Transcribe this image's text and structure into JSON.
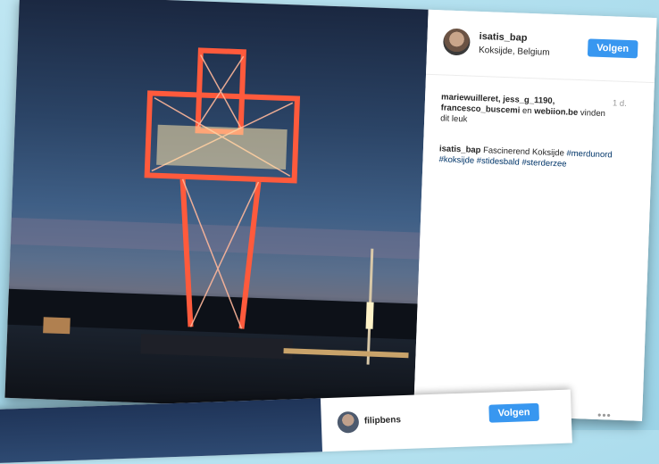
{
  "post": {
    "username": "isatis_bap",
    "location": "Koksijde, Belgium",
    "follow_label": "Volgen",
    "likes_users": "mariewuilleret, jess_g_1190, francesco_buscemi",
    "likes_and": "en",
    "likes_last": "webiion.be",
    "likes_suffix": "vinden dit leuk",
    "time": "1 d.",
    "caption_user": "isatis_bap",
    "caption_text": "Fascinerend Koksijde",
    "hashtags": "#merdunord #koksijde #stidesbald #sterderzee",
    "more_icon": "•••"
  },
  "next_post": {
    "username": "filipbens",
    "follow_label": "Volgen"
  },
  "icons": {
    "avatar": "avatar",
    "more": "more-options-icon"
  }
}
